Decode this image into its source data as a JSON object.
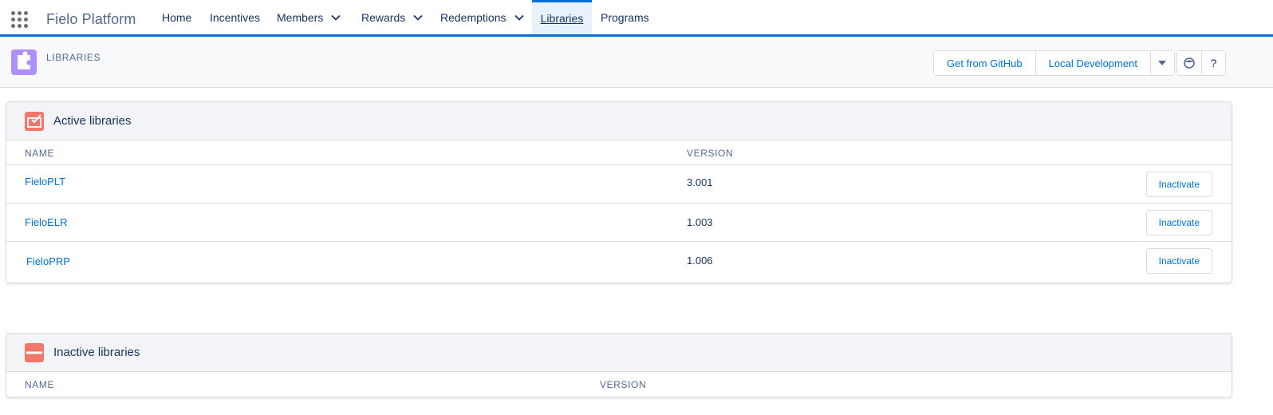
{
  "app": {
    "name": "Fielo Platform"
  },
  "nav": {
    "items": [
      {
        "label": "Home"
      },
      {
        "label": "Incentives"
      },
      {
        "label": "Members"
      },
      {
        "label": "Rewards"
      },
      {
        "label": "Redemptions"
      },
      {
        "label": "Libraries"
      },
      {
        "label": "Programs"
      }
    ],
    "active": "Libraries"
  },
  "header": {
    "title": "LIBRARIES",
    "buttons": {
      "github": "Get from GitHub",
      "local": "Local Development",
      "help": "?"
    }
  },
  "active_libraries": {
    "title": "Active libraries",
    "columns": {
      "name": "NAME",
      "version": "VERSION"
    },
    "rows": [
      {
        "name": "FieloPLT",
        "version": "3.001",
        "action": "Inactivate"
      },
      {
        "name": "FieloELR",
        "version": "1.003",
        "action": "Inactivate"
      },
      {
        "name": "FieloPRP",
        "version": "1.006",
        "action": "Inactivate"
      }
    ]
  },
  "inactive_libraries": {
    "title": "Inactive libraries",
    "columns": {
      "name": "NAME",
      "version": "VERSION"
    }
  },
  "colors": {
    "brand": "#0070d2",
    "header_icon": "#ae8fff",
    "card_icon": "#f0776a"
  }
}
